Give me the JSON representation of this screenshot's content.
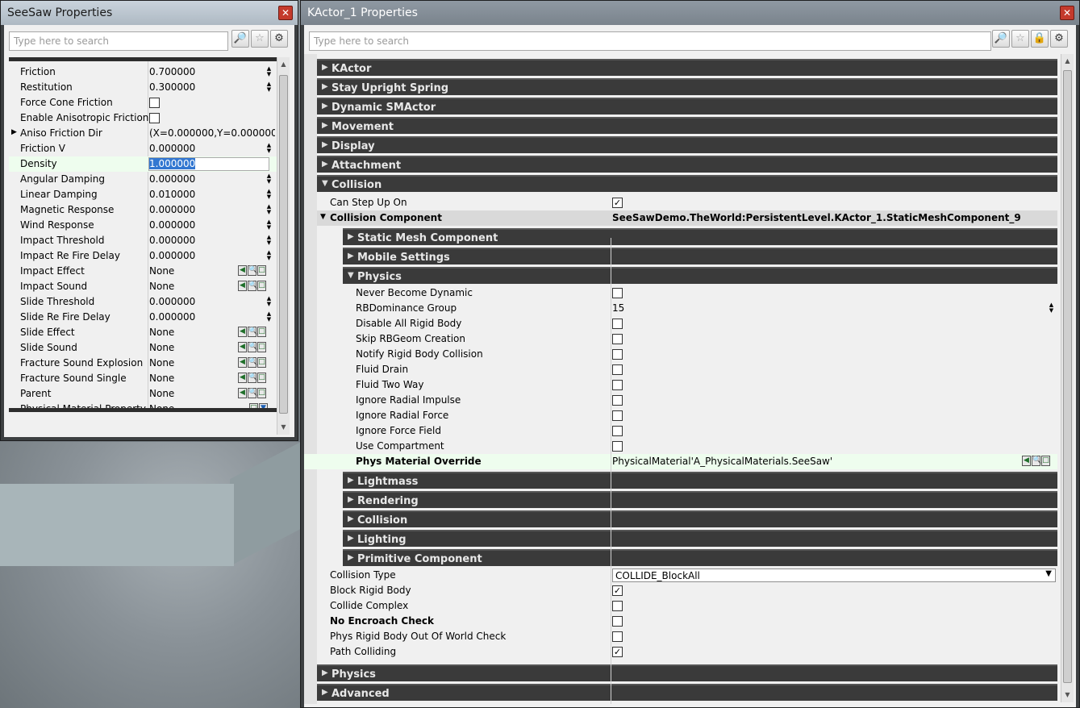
{
  "left": {
    "title": "SeeSaw Properties",
    "search_placeholder": "Type here to search",
    "rows": [
      {
        "name": "Friction",
        "value": "0.700000",
        "kind": "spin"
      },
      {
        "name": "Restitution",
        "value": "0.300000",
        "kind": "spin"
      },
      {
        "name": "Force Cone Friction",
        "value": "",
        "kind": "check",
        "checked": false
      },
      {
        "name": "Enable Anisotropic Friction",
        "value": "",
        "kind": "check",
        "checked": false
      },
      {
        "name": "Aniso Friction Dir",
        "value": "(X=0.000000,Y=0.000000,Z",
        "kind": "text",
        "expander": true
      },
      {
        "name": "Friction V",
        "value": "0.000000",
        "kind": "spin"
      },
      {
        "name": "Density",
        "value": "1.000000",
        "kind": "edit"
      },
      {
        "name": "Angular Damping",
        "value": "0.000000",
        "kind": "spin"
      },
      {
        "name": "Linear Damping",
        "value": "0.010000",
        "kind": "spin"
      },
      {
        "name": "Magnetic Response",
        "value": "0.000000",
        "kind": "spin"
      },
      {
        "name": "Wind Response",
        "value": "0.000000",
        "kind": "spin"
      },
      {
        "name": "Impact Threshold",
        "value": "0.000000",
        "kind": "spin"
      },
      {
        "name": "Impact Re Fire Delay",
        "value": "0.000000",
        "kind": "spin"
      },
      {
        "name": "Impact Effect",
        "value": "None",
        "kind": "asset"
      },
      {
        "name": "Impact Sound",
        "value": "None",
        "kind": "asset"
      },
      {
        "name": "Slide Threshold",
        "value": "0.000000",
        "kind": "spin"
      },
      {
        "name": "Slide Re Fire Delay",
        "value": "0.000000",
        "kind": "spin"
      },
      {
        "name": "Slide Effect",
        "value": "None",
        "kind": "asset"
      },
      {
        "name": "Slide Sound",
        "value": "None",
        "kind": "asset"
      },
      {
        "name": "Fracture Sound Explosion",
        "value": "None",
        "kind": "asset"
      },
      {
        "name": "Fracture Sound Single",
        "value": "None",
        "kind": "asset"
      },
      {
        "name": "Parent",
        "value": "None",
        "kind": "asset"
      },
      {
        "name": "Physical Material Property",
        "value": "None",
        "kind": "dropdown"
      }
    ]
  },
  "right": {
    "title": "KActor_1 Properties",
    "search_placeholder": "Type here to search",
    "top_categories": [
      "KActor",
      "Stay Upright Spring",
      "Dynamic SMActor",
      "Movement",
      "Display",
      "Attachment"
    ],
    "collision_category": "Collision",
    "can_step_up_on": {
      "name": "Can Step Up On",
      "checked": true
    },
    "collision_component": {
      "name": "Collision Component",
      "value": "SeeSawDemo.TheWorld:PersistentLevel.KActor_1.StaticMeshComponent_9"
    },
    "sub_categories_top": [
      "Static Mesh Component",
      "Mobile Settings"
    ],
    "physics_sub": "Physics",
    "physics_rows": [
      {
        "name": "Never Become Dynamic",
        "kind": "check",
        "checked": false
      },
      {
        "name": "RBDominance Group",
        "kind": "spin",
        "value": "15"
      },
      {
        "name": "Disable All Rigid Body",
        "kind": "check",
        "checked": false
      },
      {
        "name": "Skip RBGeom Creation",
        "kind": "check",
        "checked": false
      },
      {
        "name": "Notify Rigid Body Collision",
        "kind": "check",
        "checked": false
      },
      {
        "name": "Fluid Drain",
        "kind": "check",
        "checked": false
      },
      {
        "name": "Fluid Two Way",
        "kind": "check",
        "checked": false
      },
      {
        "name": "Ignore Radial Impulse",
        "kind": "check",
        "checked": false
      },
      {
        "name": "Ignore Radial Force",
        "kind": "check",
        "checked": false
      },
      {
        "name": "Ignore Force Field",
        "kind": "check",
        "checked": false
      },
      {
        "name": "Use Compartment",
        "kind": "check",
        "checked": false
      }
    ],
    "phys_material_override": {
      "name": "Phys Material Override",
      "value": "PhysicalMaterial'A_PhysicalMaterials.SeeSaw'"
    },
    "sub_categories_bottom": [
      "Lightmass",
      "Rendering",
      "Collision",
      "Lighting",
      "Primitive Component"
    ],
    "collision_rows": [
      {
        "name": "Collision Type",
        "kind": "dropdown",
        "value": "COLLIDE_BlockAll",
        "bold": false
      },
      {
        "name": "Block Rigid Body",
        "kind": "check",
        "checked": true,
        "bold": false
      },
      {
        "name": "Collide Complex",
        "kind": "check",
        "checked": false,
        "bold": false
      },
      {
        "name": "No Encroach Check",
        "kind": "check",
        "checked": false,
        "bold": true
      },
      {
        "name": "Phys Rigid Body Out Of World Check",
        "kind": "check",
        "checked": false,
        "bold": false
      },
      {
        "name": "Path Colliding",
        "kind": "check",
        "checked": true,
        "bold": false
      }
    ],
    "bottom_categories": [
      "Physics",
      "Advanced"
    ]
  }
}
